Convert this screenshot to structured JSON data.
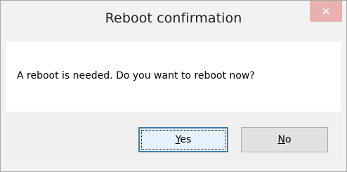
{
  "dialog": {
    "title": "Reboot confirmation",
    "close_icon": "close-icon",
    "message": "A reboot is needed. Do you want to reboot now?"
  },
  "buttons": {
    "yes": {
      "mnemonic": "Y",
      "rest": "es"
    },
    "no": {
      "mnemonic": "N",
      "rest": "o"
    }
  },
  "colors": {
    "close_button_bg": "#e8b0ae",
    "focused_button_border": "#3c7fb1",
    "dialog_bg": "#f2f2f2",
    "content_bg": "#ffffff"
  }
}
